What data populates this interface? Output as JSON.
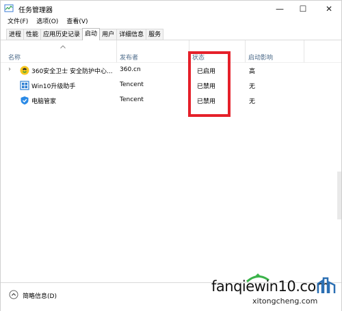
{
  "window": {
    "title": "任务管理器",
    "controls": {
      "minimize": "—",
      "maximize": "☐",
      "close": "✕"
    }
  },
  "menu": [
    "文件(F)",
    "选项(O)",
    "查看(V)"
  ],
  "tabs": [
    {
      "label": "进程",
      "active": false
    },
    {
      "label": "性能",
      "active": false
    },
    {
      "label": "应用历史记录",
      "active": false
    },
    {
      "label": "启动",
      "active": true
    },
    {
      "label": "用户",
      "active": false
    },
    {
      "label": "详细信息",
      "active": false
    },
    {
      "label": "服务",
      "active": false
    }
  ],
  "columns": {
    "name": "名称",
    "publisher": "发布者",
    "status": "状态",
    "impact": "启动影响"
  },
  "rows": [
    {
      "name": "360安全卫士 安全防护中心...",
      "publisher": "360.cn",
      "status": "已启用",
      "impact": "高",
      "icon": "360-security-icon",
      "expandable": true
    },
    {
      "name": "Win10升级助手",
      "publisher": "Tencent",
      "status": "已禁用",
      "impact": "无",
      "icon": "win10-upgrade-icon",
      "expandable": false
    },
    {
      "name": "电脑管家",
      "publisher": "Tencent",
      "status": "已禁用",
      "impact": "无",
      "icon": "pc-manager-icon",
      "expandable": false
    }
  ],
  "footer": {
    "less_info": "简略信息(D)"
  },
  "watermark": {
    "main": "fanqiewin10.com",
    "sub": "xitongcheng.com"
  },
  "colors": {
    "highlight": "#e5202a",
    "header_text": "#4d6b8a"
  }
}
